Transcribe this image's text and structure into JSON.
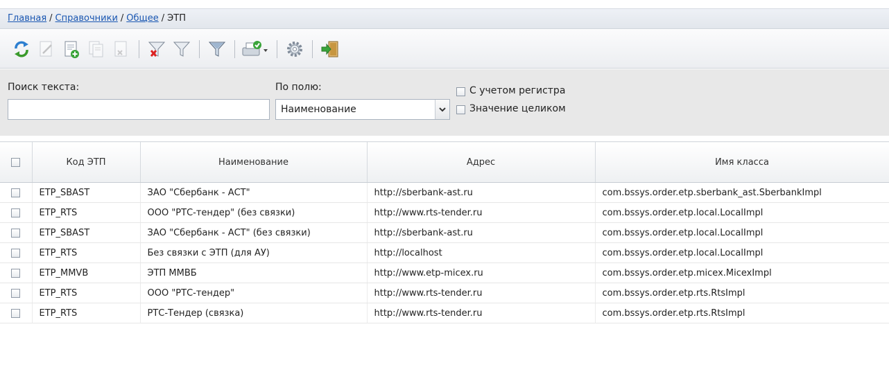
{
  "breadcrumb": {
    "home": "Главная",
    "sep1": "/",
    "dictionaries": "Справочники",
    "sep2": "/",
    "general": "Общее",
    "sep3": "/",
    "current": "ЭТП"
  },
  "toolbar": {
    "buttons": [
      "refresh-icon",
      "edit-icon",
      "add-icon",
      "copy-icon",
      "delete-icon",
      "clear-filter-icon",
      "filter-icon",
      "filter-apply-icon",
      "print-export-icon",
      "settings-icon",
      "exit-icon"
    ]
  },
  "search": {
    "text_label": "Поиск текста:",
    "text_value": "",
    "field_label": "По полю:",
    "field_value": "Наименование",
    "case_label": "С учетом регистра",
    "whole_label": "Значение целиком"
  },
  "grid": {
    "columns": [
      "Код ЭТП",
      "Наименование",
      "Адрес",
      "Имя класса"
    ],
    "rows": [
      [
        "ETP_SBAST",
        "ЗАО \"Сбербанк - АСТ\"",
        "http://sberbank-ast.ru",
        "com.bssys.order.etp.sberbank_ast.SberbankImpl"
      ],
      [
        "ETP_RTS",
        "ООО \"РТС-тендер\" (без связки)",
        "http://www.rts-tender.ru",
        "com.bssys.order.etp.local.LocalImpl"
      ],
      [
        "ETP_SBAST",
        "ЗАО \"Сбербанк - АСТ\" (без связки)",
        "http://sberbank-ast.ru",
        "com.bssys.order.etp.local.LocalImpl"
      ],
      [
        "ETP_RTS",
        "Без связки с ЭТП (для АУ)",
        "http://localhost",
        "com.bssys.order.etp.local.LocalImpl"
      ],
      [
        "ETP_MMVB",
        "ЭТП ММВБ",
        "http://www.etp-micex.ru",
        "com.bssys.order.etp.micex.MicexImpl"
      ],
      [
        "ETP_RTS",
        "ООО \"РТС-тендер\"",
        "http://www.rts-tender.ru",
        "com.bssys.order.etp.rts.RtsImpl"
      ],
      [
        "ETP_RTS",
        "РТС-Тендер (связка)",
        "http://www.rts-tender.ru",
        "com.bssys.order.etp.rts.RtsImpl"
      ]
    ]
  }
}
